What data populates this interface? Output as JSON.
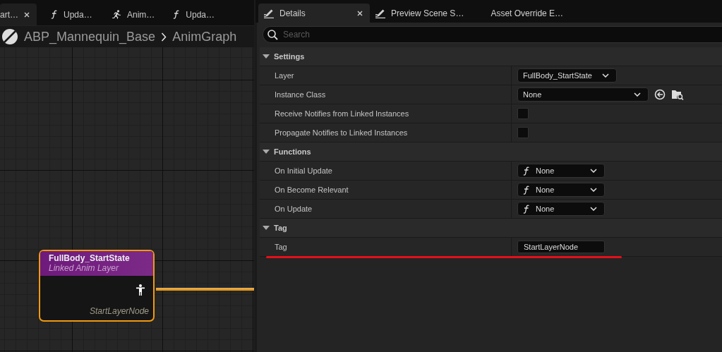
{
  "graph_tabs": [
    {
      "label": "art…",
      "kind": "plain",
      "selected": true,
      "closable": true
    },
    {
      "label": "Upda…",
      "kind": "function",
      "selected": false,
      "closable": false
    },
    {
      "label": "Anim…",
      "kind": "anim",
      "selected": false,
      "closable": false
    },
    {
      "label": "Upda…",
      "kind": "function",
      "selected": false,
      "closable": false
    }
  ],
  "breadcrumb": [
    "ABP_Mannequin_Base",
    "AnimGraph"
  ],
  "node": {
    "title": "FullBody_StartState",
    "subtitle": "Linked Anim Layer",
    "footer": "StartLayerNode",
    "selected": true
  },
  "details_tabs": [
    {
      "label": "Details",
      "kind": "pencil",
      "selected": true,
      "closable": true
    },
    {
      "label": "Preview Scene S…",
      "kind": "pencil",
      "selected": false,
      "closable": false
    },
    {
      "label": "Asset Override E…",
      "kind": "plain",
      "selected": false,
      "closable": false
    }
  ],
  "search": {
    "placeholder": "Search"
  },
  "sections": [
    {
      "title": "Settings",
      "expanded": true,
      "rows": [
        {
          "label": "Layer",
          "kind": "dropdown",
          "value": "FullBody_StartState",
          "underlined": false
        },
        {
          "label": "Instance Class",
          "kind": "class_picker",
          "value": "None",
          "underlined": false
        },
        {
          "label": "Receive Notifies from Linked Instances",
          "kind": "checkbox",
          "checked": false,
          "underlined": false
        },
        {
          "label": "Propagate Notifies to Linked Instances",
          "kind": "checkbox",
          "checked": false,
          "underlined": false
        }
      ]
    },
    {
      "title": "Functions",
      "expanded": true,
      "rows": [
        {
          "label": "On Initial Update",
          "kind": "function",
          "value": "None",
          "underlined": false
        },
        {
          "label": "On Become Relevant",
          "kind": "function",
          "value": "None",
          "underlined": false
        },
        {
          "label": "On Update",
          "kind": "function",
          "value": "None",
          "underlined": false
        }
      ]
    },
    {
      "title": "Tag",
      "expanded": true,
      "rows": [
        {
          "label": "Tag",
          "kind": "text",
          "value": "StartLayerNode",
          "underlined": true
        }
      ]
    }
  ]
}
